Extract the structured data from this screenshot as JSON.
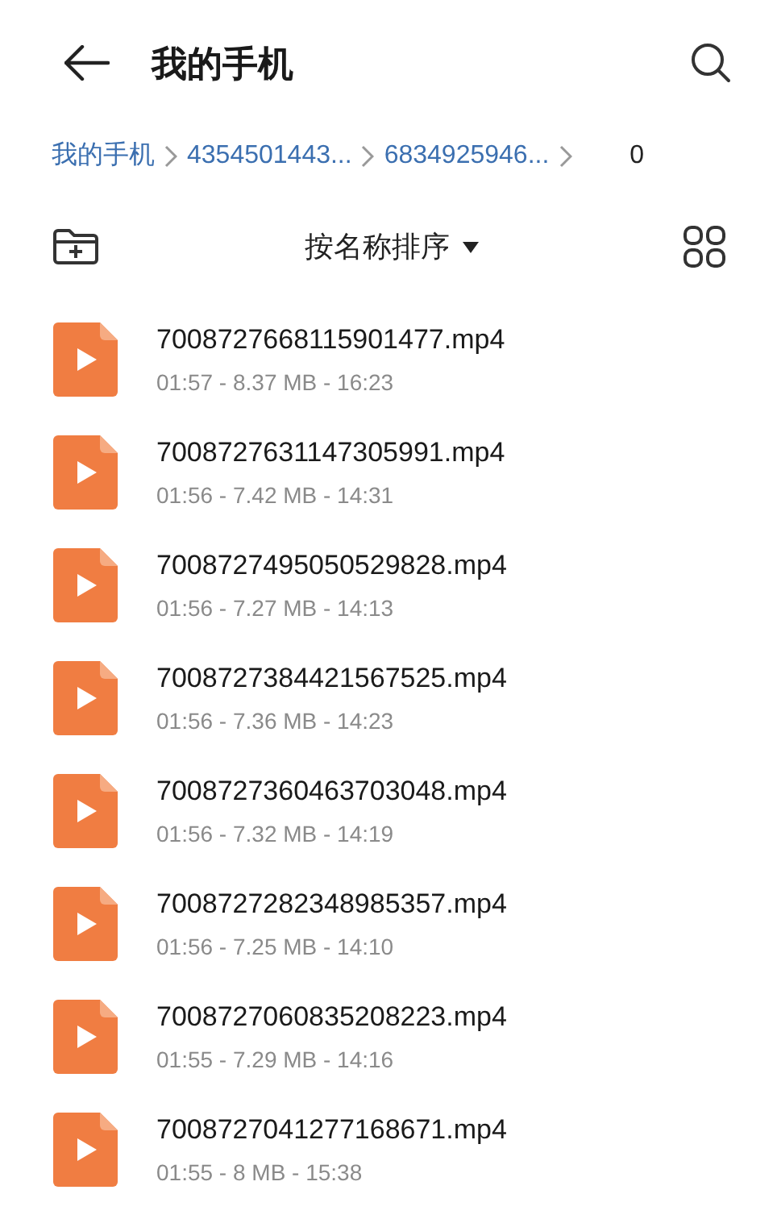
{
  "header": {
    "title": "我的手机"
  },
  "breadcrumb": {
    "items": [
      "我的手机",
      "4354501443...",
      "6834925946..."
    ],
    "count": "0"
  },
  "toolbar": {
    "sort_label": "按名称排序"
  },
  "files": [
    {
      "name": "7008727668115901477.mp4",
      "meta": "01:57 - 8.37 MB - 16:23"
    },
    {
      "name": "7008727631147305991.mp4",
      "meta": "01:56 - 7.42 MB - 14:31"
    },
    {
      "name": "7008727495050529828.mp4",
      "meta": "01:56 - 7.27 MB - 14:13"
    },
    {
      "name": "7008727384421567525.mp4",
      "meta": "01:56 - 7.36 MB - 14:23"
    },
    {
      "name": "7008727360463703048.mp4",
      "meta": "01:56 - 7.32 MB - 14:19"
    },
    {
      "name": "7008727282348985357.mp4",
      "meta": "01:56 - 7.25 MB - 14:10"
    },
    {
      "name": "7008727060835208223.mp4",
      "meta": "01:55 - 7.29 MB - 14:16"
    },
    {
      "name": "7008727041277168671.mp4",
      "meta": "01:55 - 8 MB - 15:38"
    }
  ]
}
